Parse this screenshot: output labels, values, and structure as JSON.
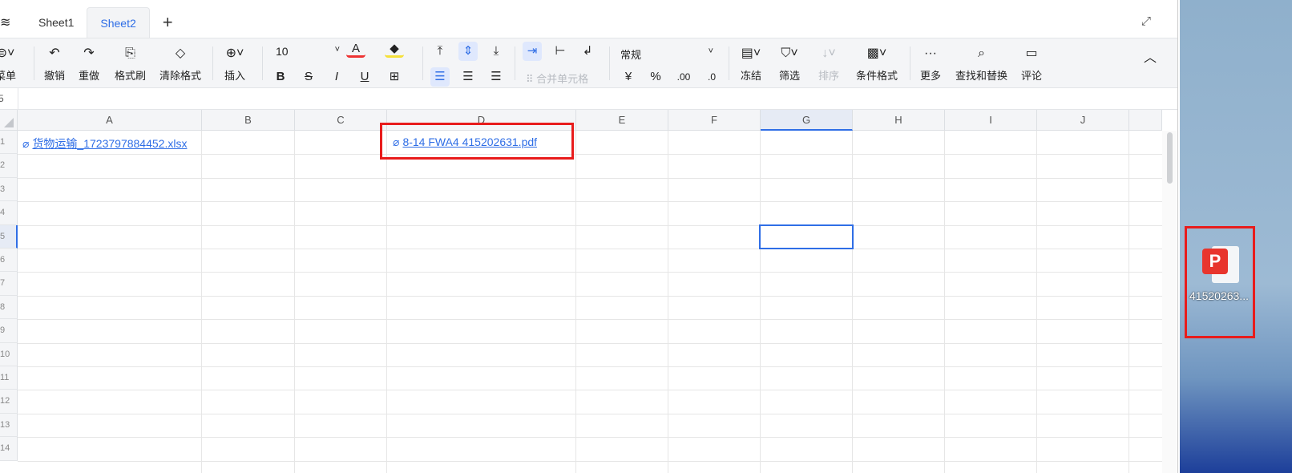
{
  "tabs": {
    "items": [
      {
        "label": "Sheet1",
        "active": false
      },
      {
        "label": "Sheet2",
        "active": true
      }
    ],
    "add": "+"
  },
  "toolbar": {
    "menu": "菜单",
    "undo": "撤销",
    "redo": "重做",
    "format_painter": "格式刷",
    "clear_format": "清除格式",
    "insert": "插入",
    "font_size": "10",
    "bold": "B",
    "strike": "S",
    "italic": "I",
    "underline": "U",
    "merge": "合并单元格",
    "number_format": "常规",
    "currency": "¥",
    "percent": "%",
    "inc_decimal": ".00",
    "dec_decimal": ".0",
    "freeze": "冻结",
    "filter": "筛选",
    "sort": "排序",
    "conditional": "条件格式",
    "more": "更多",
    "find_replace": "查找和替换",
    "comment": "评论"
  },
  "formula_bar": {
    "cell_ref_partial": "5"
  },
  "grid": {
    "columns": [
      "A",
      "B",
      "C",
      "D",
      "E",
      "F",
      "G",
      "H",
      "I",
      "J"
    ],
    "rows": [
      "1",
      "2",
      "3",
      "4",
      "5",
      "6",
      "7",
      "8",
      "9",
      "10",
      "11",
      "12",
      "13",
      "14"
    ],
    "selected_cell": "G5",
    "cells": {
      "A1": "货物运输_1723797884452.xlsx",
      "D1": "8-14 FWA4 415202631.pdf"
    }
  },
  "desktop": {
    "icon_label": "41520263..."
  },
  "colors": {
    "accent": "#2f6ee6",
    "highlight": "#e81c1c"
  }
}
